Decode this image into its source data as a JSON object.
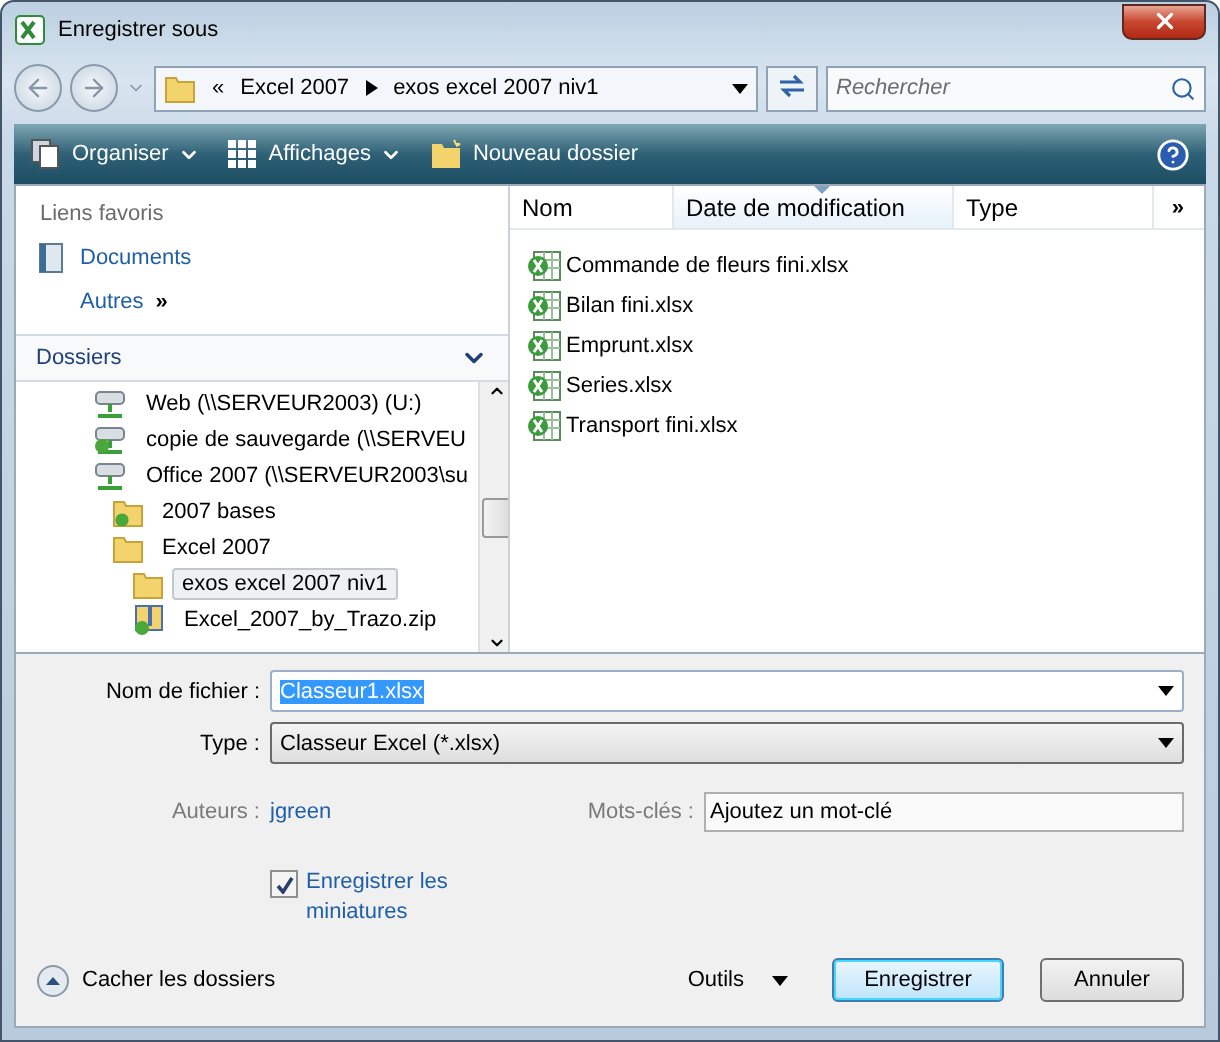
{
  "window": {
    "title": "Enregistrer sous"
  },
  "address_bar": {
    "overflow": "«",
    "path": [
      "Excel 2007",
      "exos excel 2007 niv1"
    ]
  },
  "search": {
    "placeholder": "Rechercher"
  },
  "toolbar": [
    {
      "label": "Organiser",
      "kind": "menu"
    },
    {
      "label": "Affichages",
      "kind": "menu"
    },
    {
      "label": "Nouveau dossier",
      "kind": "new-folder"
    }
  ],
  "favorites": {
    "heading": "Liens favoris",
    "items": [
      {
        "label": "Documents",
        "kind": "documents"
      },
      {
        "label": "Autres",
        "kind": "more",
        "glyph": "»"
      }
    ]
  },
  "folders": {
    "heading": "Dossiers",
    "expanded": true,
    "tree": [
      {
        "label": "Web (\\\\SERVEUR2003) (U:)",
        "kind": "drive",
        "selected": false
      },
      {
        "label": "copie de sauvegarde (\\\\SERVEU",
        "kind": "sync-drive",
        "selected": false
      },
      {
        "label": "Office 2007 (\\\\SERVEUR2003\\su",
        "kind": "drive",
        "selected": false,
        "children": [
          {
            "label": "2007 bases",
            "kind": "sync-folder",
            "selected": false
          },
          {
            "label": "Excel 2007",
            "kind": "folder",
            "selected": false,
            "children": [
              {
                "label": "exos excel 2007 niv1",
                "kind": "folder",
                "selected": true
              },
              {
                "label": "Excel_2007_by_Trazo.zip",
                "kind": "zip",
                "selected": false
              }
            ]
          }
        ]
      }
    ]
  },
  "file_list": {
    "columns": [
      {
        "label": "Nom",
        "sorted": false
      },
      {
        "label": "Date de modification",
        "sorted": true
      },
      {
        "label": "Type",
        "sorted": false
      }
    ],
    "more": "»",
    "files": [
      "Commande de fleurs fini.xlsx",
      "Bilan fini.xlsx",
      "Emprunt.xlsx",
      "Series.xlsx",
      "Transport fini.xlsx"
    ]
  },
  "form": {
    "file_name": {
      "label": "Nom de fichier :",
      "value": "Classeur1.xlsx"
    },
    "type": {
      "label": "Type :",
      "value": "Classeur Excel (*.xlsx)"
    },
    "authors": {
      "label": "Auteurs :",
      "value": "jgreen"
    },
    "keywords": {
      "label": "Mots-clés :",
      "placeholder": "Ajoutez un mot-clé"
    },
    "thumbnails": {
      "label": "Enregistrer les miniatures",
      "checked": true
    }
  },
  "footer": {
    "hide_folders": "Cacher les dossiers",
    "tools": "Outils",
    "buttons": [
      {
        "label": "Enregistrer",
        "default": true
      },
      {
        "label": "Annuler",
        "default": false
      }
    ]
  }
}
